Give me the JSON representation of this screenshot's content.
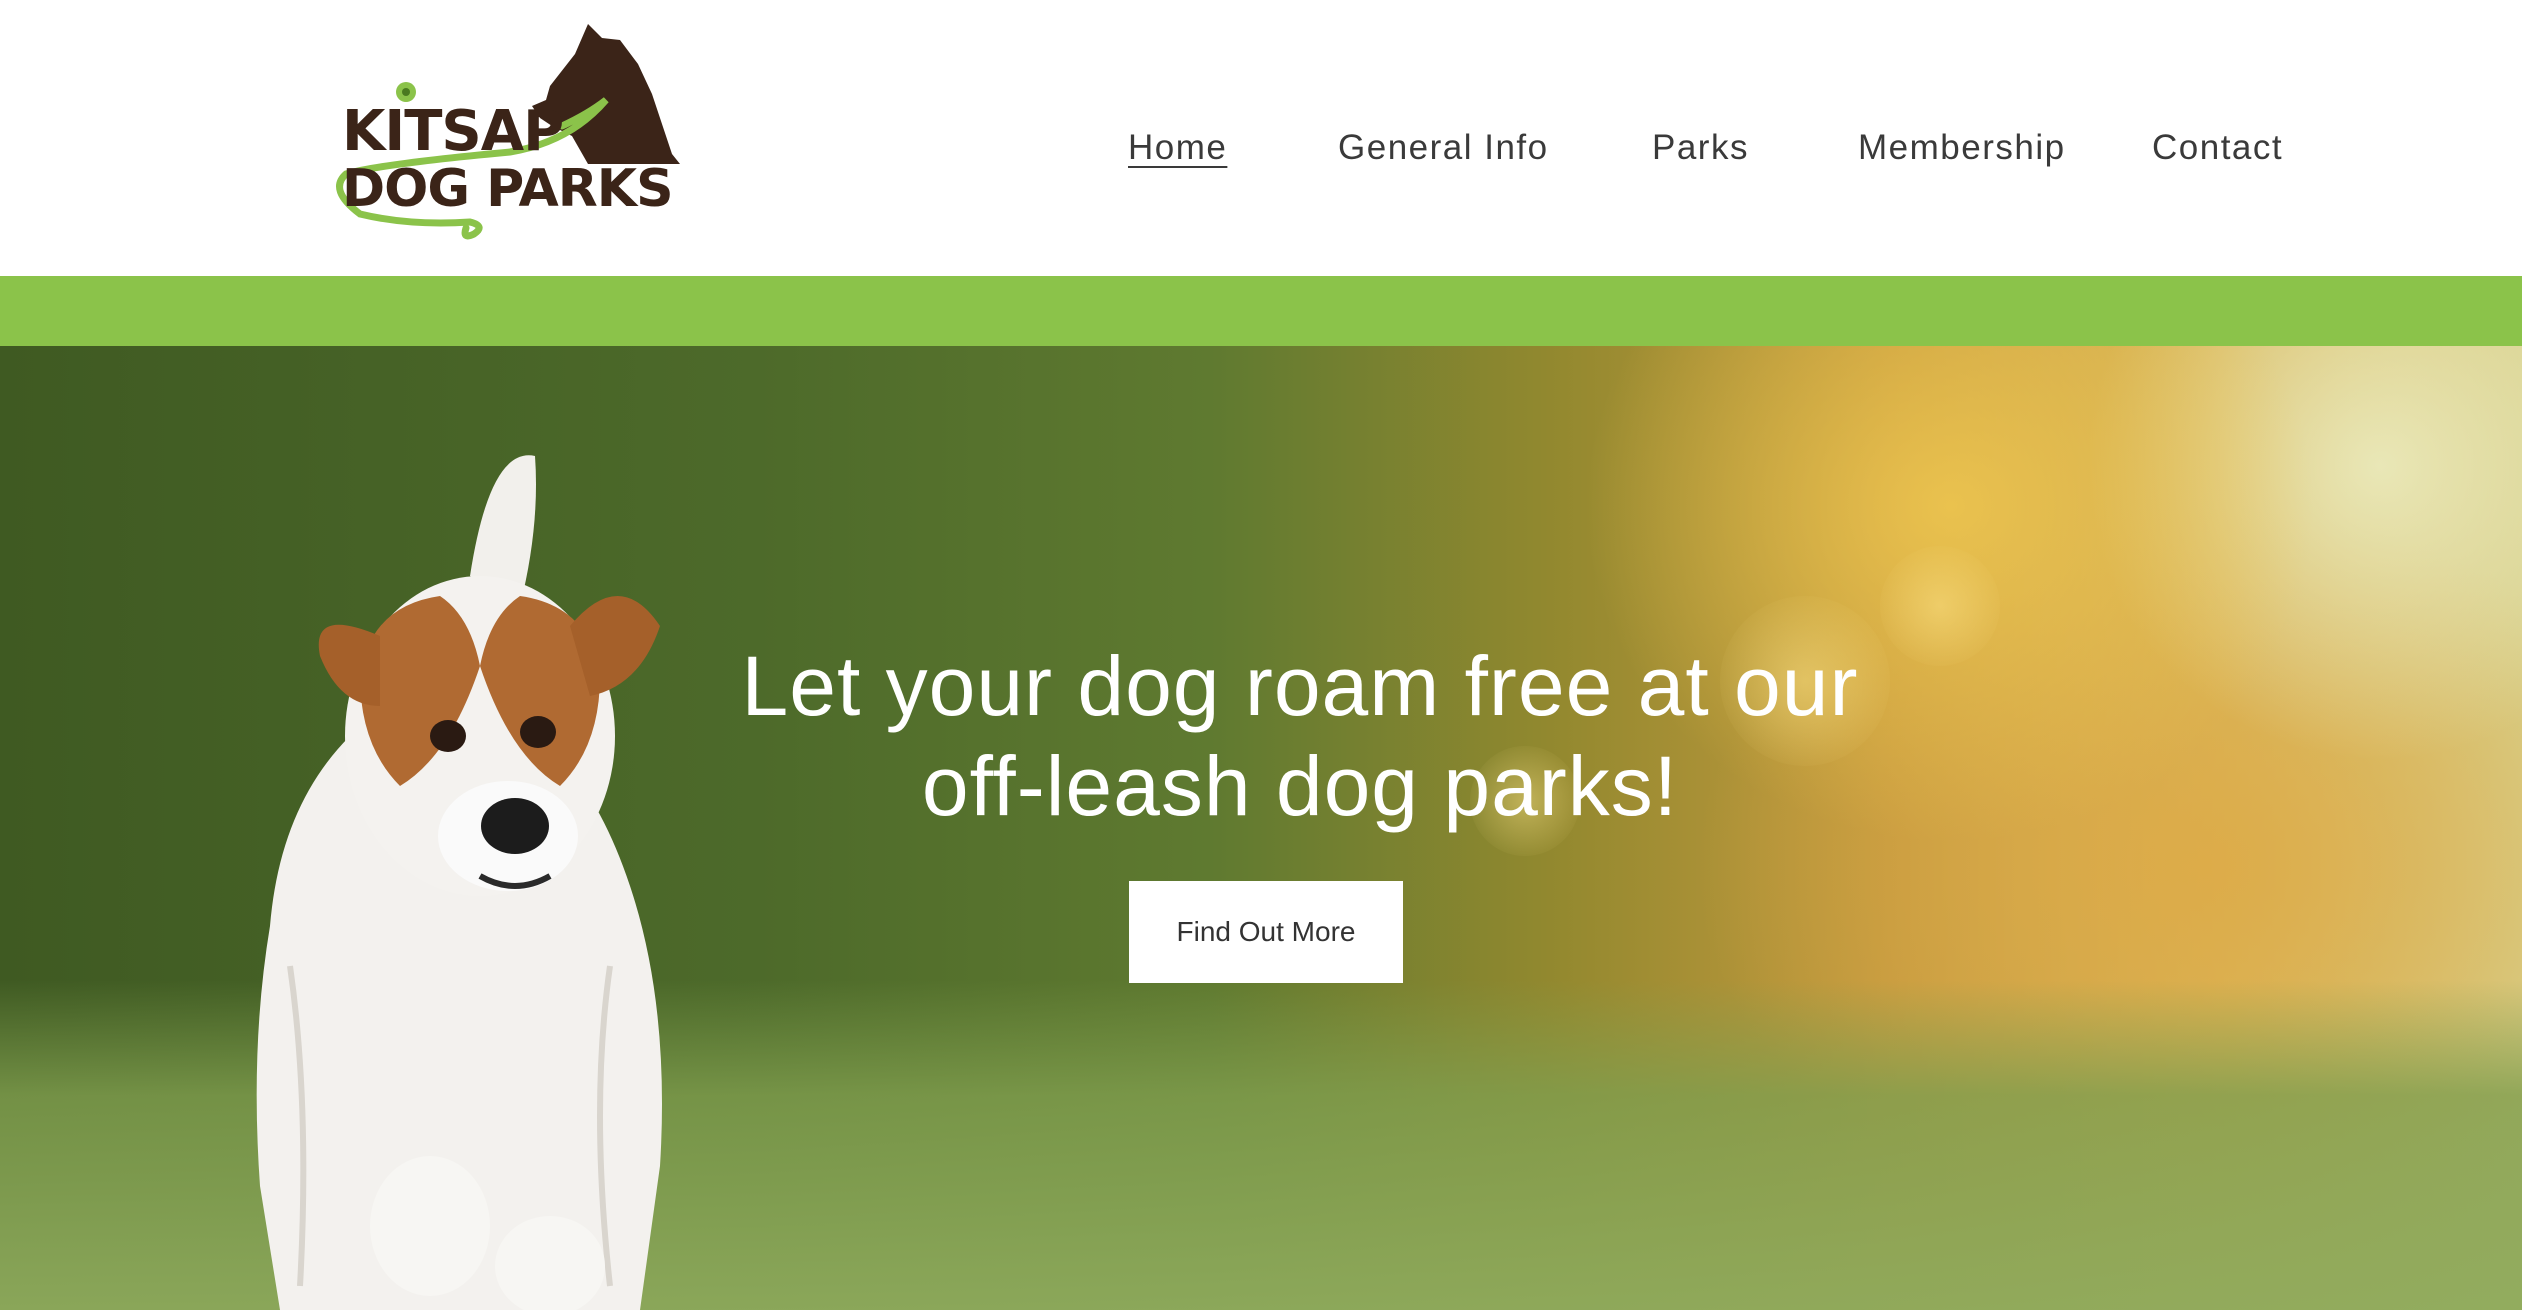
{
  "logo": {
    "line1": "KITSAP",
    "line2": "DOG PARKS",
    "icon": "dog-silhouette-icon"
  },
  "nav": {
    "items": [
      {
        "label": "Home",
        "active": true
      },
      {
        "label": "General Info",
        "active": false
      },
      {
        "label": "Parks",
        "active": false
      },
      {
        "label": "Membership",
        "active": false
      },
      {
        "label": "Contact",
        "active": false
      }
    ]
  },
  "hero": {
    "title_line1": "Let your dog roam free at our",
    "title_line2": "off-leash dog parks!",
    "button_label": "Find Out More"
  },
  "colors": {
    "accent_green": "#8bc34a",
    "logo_brown": "#3b2418",
    "text_dark": "#333333"
  }
}
